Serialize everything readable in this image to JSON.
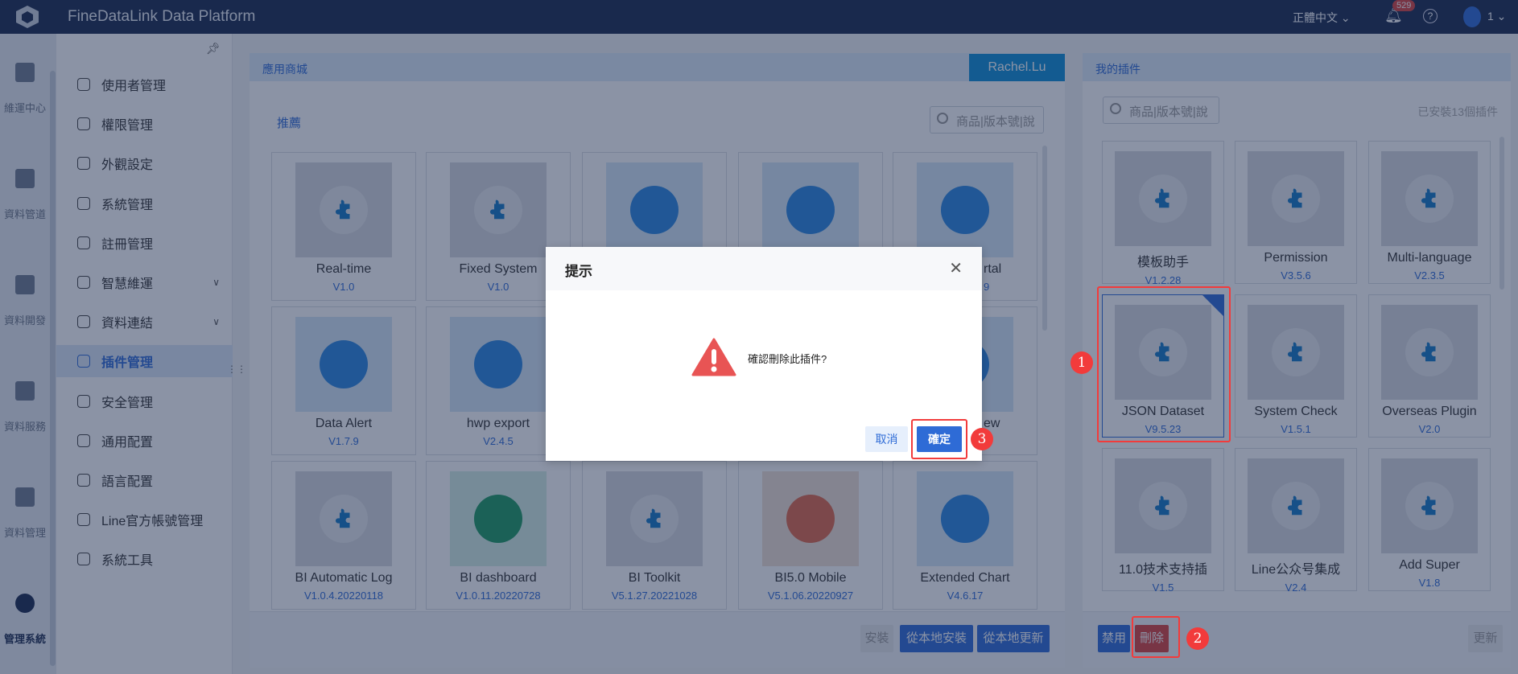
{
  "topbar": {
    "title": "FineDataLink Data Platform",
    "language": "正體中文",
    "notification_count": "529",
    "user": "1"
  },
  "rail": [
    {
      "label": "維運中心"
    },
    {
      "label": "資料管道"
    },
    {
      "label": "資料開發"
    },
    {
      "label": "資料服務"
    },
    {
      "label": "資料管理"
    },
    {
      "label": "管理系統",
      "active": true
    }
  ],
  "subnav": [
    {
      "label": "使用者管理"
    },
    {
      "label": "權限管理"
    },
    {
      "label": "外觀設定"
    },
    {
      "label": "系統管理"
    },
    {
      "label": "註冊管理"
    },
    {
      "label": "智慧維運",
      "chevron": true
    },
    {
      "label": "資料連結",
      "chevron": true
    },
    {
      "label": "插件管理",
      "active": true
    },
    {
      "label": "安全管理"
    },
    {
      "label": "通用配置"
    },
    {
      "label": "語言配置"
    },
    {
      "label": "Line官方帳號管理"
    },
    {
      "label": "系統工具"
    }
  ],
  "store": {
    "title": "應用商城",
    "user": "Rachel.Lu",
    "section": "推薦",
    "search_placeholder": "商品|版本號|說",
    "cards": [
      {
        "name": "Real-time",
        "version": "V1.0",
        "style": "gray"
      },
      {
        "name": "Fixed System",
        "version": "V1.0",
        "style": "gray"
      },
      {
        "name": "",
        "version": "",
        "style": "blue"
      },
      {
        "name": "",
        "version": "",
        "style": "blue"
      },
      {
        "name": "rtal",
        "version": "9",
        "style": "blue",
        "partial": true
      },
      {
        "name": "Data Alert",
        "version": "V1.7.9",
        "style": "blue"
      },
      {
        "name": "hwp export",
        "version": "V2.4.5",
        "style": "blue"
      },
      {
        "name": "",
        "version": "",
        "style": "blue"
      },
      {
        "name": "",
        "version": "",
        "style": "blue"
      },
      {
        "name": "ew",
        "version": "",
        "style": "blue",
        "partial": true
      },
      {
        "name": "BI Automatic Log",
        "version": "V1.0.4.20220118",
        "style": "gray"
      },
      {
        "name": "BI dashboard",
        "version": "V1.0.11.20220728",
        "style": "green"
      },
      {
        "name": "BI Toolkit",
        "version": "V5.1.27.20221028",
        "style": "gray"
      },
      {
        "name": "BI5.0 Mobile",
        "version": "V5.1.06.20220927",
        "style": "orange"
      },
      {
        "name": "Extended Chart",
        "version": "V4.6.17",
        "style": "blue"
      }
    ],
    "buttons": {
      "install": "安裝",
      "install_local": "從本地安裝",
      "update_local": "從本地更新"
    }
  },
  "mine": {
    "title": "我的插件",
    "search_placeholder": "商品|版本號|說",
    "installed": "已安裝13個插件",
    "cards": [
      {
        "name": "模板助手",
        "version": "V1.2.28"
      },
      {
        "name": "Permission",
        "version": "V3.5.6"
      },
      {
        "name": "Multi-language",
        "version": "V2.3.5"
      },
      {
        "name": "JSON Dataset",
        "version": "V9.5.23",
        "selected": true
      },
      {
        "name": "System Check",
        "version": "V1.5.1"
      },
      {
        "name": "Overseas Plugin",
        "version": "V2.0"
      },
      {
        "name": "11.0技术支持插",
        "version": "V1.5"
      },
      {
        "name": "Line公众号集成",
        "version": "V2.4"
      },
      {
        "name": "Add Super",
        "version": "V1.8"
      }
    ],
    "buttons": {
      "disable": "禁用",
      "delete": "刪除",
      "update": "更新"
    }
  },
  "dialog": {
    "title": "提示",
    "message": "確認刪除此插件?",
    "cancel": "取消",
    "confirm": "確定"
  },
  "annotations": [
    "1",
    "2",
    "3"
  ]
}
